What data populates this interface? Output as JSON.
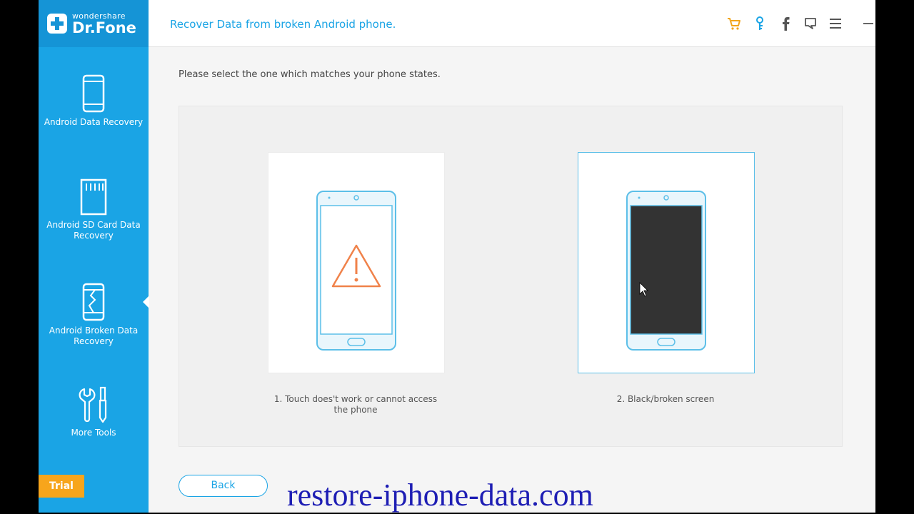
{
  "brand": {
    "small": "wondershare",
    "name": "Dr.Fone"
  },
  "header": {
    "title": "Recover Data from broken Android phone."
  },
  "toolbar_icons": [
    "cart-icon",
    "key-icon",
    "facebook-icon",
    "feedback-icon",
    "menu-icon",
    "minimize-icon",
    "close-icon"
  ],
  "sidebar": {
    "items": [
      {
        "label": "Android Data Recovery",
        "icon": "phone-icon"
      },
      {
        "label": "Android SD Card Data Recovery",
        "icon": "sd-card-icon"
      },
      {
        "label": "Android Broken Data Recovery",
        "icon": "broken-phone-icon"
      },
      {
        "label": "More Tools",
        "icon": "tools-icon"
      }
    ],
    "trial": "Trial"
  },
  "main": {
    "instruction": "Please select the one which matches your phone states.",
    "options": [
      {
        "label": "1. Touch does't work or cannot access the phone",
        "icon": "warning-phone-icon"
      },
      {
        "label": "2. Black/broken screen",
        "icon": "black-screen-phone-icon"
      }
    ],
    "back_label": "Back"
  },
  "watermark": "restore-iphone-data.com",
  "colors": {
    "accent": "#1aa4e5",
    "sidebar": "#1aa4e5",
    "trial": "#f7a51c",
    "warning": "#f0824a",
    "screen": "#333333"
  }
}
